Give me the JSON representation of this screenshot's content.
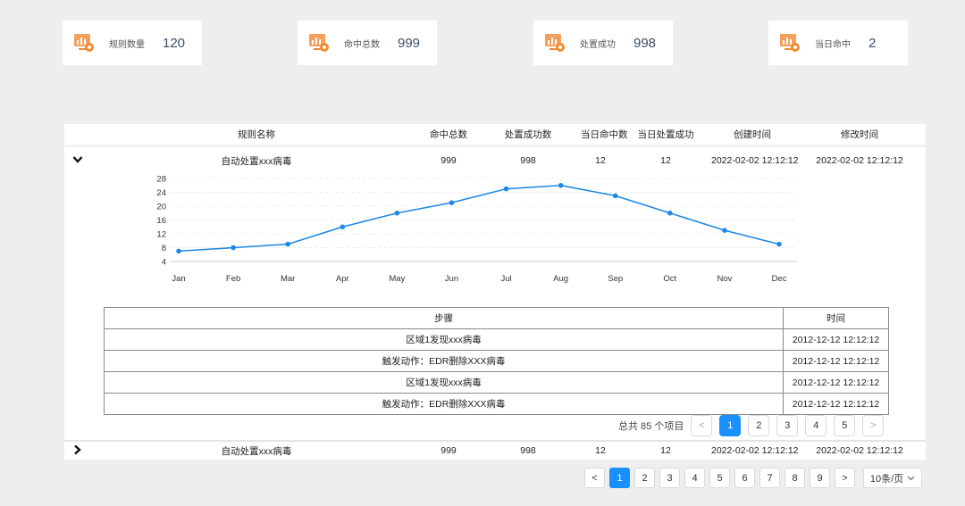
{
  "stats": [
    {
      "label": "规则数量",
      "value": "120"
    },
    {
      "label": "命中总数",
      "value": "999"
    },
    {
      "label": "处置成功",
      "value": "998"
    },
    {
      "label": "当日命中",
      "value": "2"
    }
  ],
  "table": {
    "headers": {
      "name": "规则名称",
      "hits": "命中总数",
      "success": "处置成功数",
      "today_hits": "当日命中数",
      "today_success": "当日处置成功",
      "created": "创建时间",
      "modified": "修改时间"
    },
    "rows": [
      {
        "name": "自动处置xxx病毒",
        "hits": "999",
        "success": "998",
        "today_hits": "12",
        "today_success": "12",
        "created": "2022-02-02 12:12:12",
        "modified": "2022-02-02 12:12:12"
      },
      {
        "name": "自动处置xxx病毒",
        "hits": "999",
        "success": "998",
        "today_hits": "12",
        "today_success": "12",
        "created": "2022-02-02 12:12:12",
        "modified": "2022-02-02 12:12:12"
      }
    ]
  },
  "chart_data": {
    "type": "line",
    "categories": [
      "Jan",
      "Feb",
      "Mar",
      "Apr",
      "May",
      "Jun",
      "Jul",
      "Aug",
      "Sep",
      "Oct",
      "Nov",
      "Dec"
    ],
    "values": [
      7,
      8,
      9,
      14,
      18,
      21,
      25,
      26,
      23,
      18,
      13,
      9
    ],
    "yticks": [
      "4",
      "8",
      "12",
      "16",
      "20",
      "24",
      "28"
    ],
    "ylim": [
      4,
      28
    ],
    "color": "#1e88e5",
    "grid": true
  },
  "steps": {
    "headers": {
      "step": "步骤",
      "time": "时间"
    },
    "rows": [
      {
        "step": "区域1发现xxx病毒",
        "time": "2012-12-12 12:12:12"
      },
      {
        "step": "触发动作：EDR删除XXX病毒",
        "time": "2012-12-12 12:12:12"
      },
      {
        "step": "区域1发现xxx病毒",
        "time": "2012-12-12 12:12:12"
      },
      {
        "step": "触发动作：EDR删除XXX病毒",
        "time": "2012-12-12 12:12:12"
      }
    ]
  },
  "inner_pager": {
    "total": "总共 85 个项目",
    "pages": [
      "1",
      "2",
      "3",
      "4",
      "5"
    ],
    "current": "1",
    "prev": "<",
    "next": ">"
  },
  "outer_pager": {
    "pages": [
      "1",
      "2",
      "3",
      "4",
      "5",
      "6",
      "7",
      "8",
      "9"
    ],
    "current": "1",
    "prev": "<",
    "next": ">",
    "page_size": "10条/页"
  },
  "icons": {
    "expanded": "chevron-down-icon",
    "collapsed": "chevron-right-icon",
    "stat": "chart-monitor-icon",
    "select": "chevron-down-icon"
  },
  "colors": {
    "accent": "#1890ff",
    "icon_orange": "#f28b30"
  }
}
